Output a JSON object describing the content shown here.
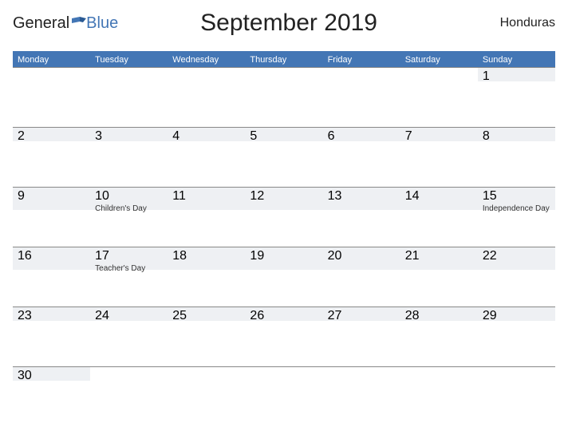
{
  "logo": {
    "text1": "General",
    "text2": "Blue"
  },
  "title": "September 2019",
  "region": "Honduras",
  "weekdays": [
    "Monday",
    "Tuesday",
    "Wednesday",
    "Thursday",
    "Friday",
    "Saturday",
    "Sunday"
  ],
  "weeks": [
    [
      {
        "n": "",
        "event": ""
      },
      {
        "n": "",
        "event": ""
      },
      {
        "n": "",
        "event": ""
      },
      {
        "n": "",
        "event": ""
      },
      {
        "n": "",
        "event": ""
      },
      {
        "n": "",
        "event": ""
      },
      {
        "n": "1",
        "event": ""
      }
    ],
    [
      {
        "n": "2",
        "event": ""
      },
      {
        "n": "3",
        "event": ""
      },
      {
        "n": "4",
        "event": ""
      },
      {
        "n": "5",
        "event": ""
      },
      {
        "n": "6",
        "event": ""
      },
      {
        "n": "7",
        "event": ""
      },
      {
        "n": "8",
        "event": ""
      }
    ],
    [
      {
        "n": "9",
        "event": ""
      },
      {
        "n": "10",
        "event": "Children's Day"
      },
      {
        "n": "11",
        "event": ""
      },
      {
        "n": "12",
        "event": ""
      },
      {
        "n": "13",
        "event": ""
      },
      {
        "n": "14",
        "event": ""
      },
      {
        "n": "15",
        "event": "Independence Day"
      }
    ],
    [
      {
        "n": "16",
        "event": ""
      },
      {
        "n": "17",
        "event": "Teacher's Day"
      },
      {
        "n": "18",
        "event": ""
      },
      {
        "n": "19",
        "event": ""
      },
      {
        "n": "20",
        "event": ""
      },
      {
        "n": "21",
        "event": ""
      },
      {
        "n": "22",
        "event": ""
      }
    ],
    [
      {
        "n": "23",
        "event": ""
      },
      {
        "n": "24",
        "event": ""
      },
      {
        "n": "25",
        "event": ""
      },
      {
        "n": "26",
        "event": ""
      },
      {
        "n": "27",
        "event": ""
      },
      {
        "n": "28",
        "event": ""
      },
      {
        "n": "29",
        "event": ""
      }
    ],
    [
      {
        "n": "30",
        "event": ""
      },
      {
        "n": "",
        "event": ""
      },
      {
        "n": "",
        "event": ""
      },
      {
        "n": "",
        "event": ""
      },
      {
        "n": "",
        "event": ""
      },
      {
        "n": "",
        "event": ""
      },
      {
        "n": "",
        "event": ""
      }
    ]
  ]
}
